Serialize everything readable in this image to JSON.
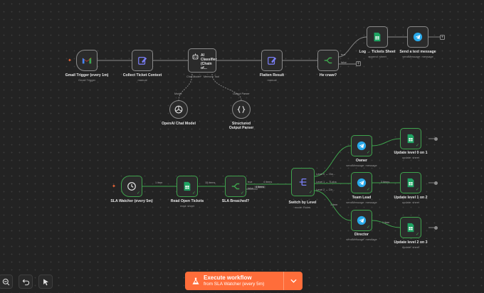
{
  "nodes": {
    "gmail_trigger": {
      "label": "Gmail Trigger (every 1m)",
      "sub": "Gmail Trigger",
      "icon": "gmail-icon"
    },
    "collect_ticket": {
      "label": "Collect Ticket Context",
      "sub": "manual",
      "icon": "edit-icon"
    },
    "ai_classifier": {
      "label": "AI Classifier (Chain of...",
      "icon": "robot-icon"
    },
    "flatten_result": {
      "label": "Flatten Result",
      "sub": "manual",
      "icon": "edit-icon"
    },
    "he_cnaw": {
      "label": "He cnaw?",
      "icon": "branch-icon"
    },
    "log_tickets": {
      "label": "Log → Tickets Sheet",
      "sub": "append: sheet",
      "icon": "sheets-icon"
    },
    "send_text": {
      "label": "Send a text message",
      "sub": "sendMessage: message",
      "icon": "telegram-icon"
    },
    "openai_model": {
      "label": "OpenAI Chat Model",
      "icon": "openai-icon"
    },
    "structured_parser": {
      "label": "Structured Output Parser",
      "icon": "braces-icon"
    },
    "sla_watcher": {
      "label": "SLA Watcher (every 5m)",
      "icon": "clock-icon"
    },
    "read_open": {
      "label": "Read Open Tickets",
      "sub": "read: sheet",
      "icon": "sheets-icon"
    },
    "sla_breached": {
      "label": "SLA Breached?",
      "icon": "branch-icon"
    },
    "switch_level": {
      "label": "Switch by Level",
      "sub": "mode: Rules",
      "icon": "switch-icon"
    },
    "owner": {
      "label": "Owner",
      "sub": "sendMessage: message",
      "icon": "telegram-icon"
    },
    "team_lead": {
      "label": "Team Lead",
      "sub": "sendMessage: message",
      "icon": "telegram-icon"
    },
    "director": {
      "label": "Director",
      "sub": "sendMessage: message",
      "icon": "telegram-icon"
    },
    "update_l0": {
      "label": "Update level 0 on 1",
      "sub": "update: sheet",
      "icon": "sheets-icon"
    },
    "update_l1": {
      "label": "Update level 1 on 2",
      "sub": "update: sheet",
      "icon": "sheets-icon"
    },
    "update_l2": {
      "label": "Update level 2 on 3",
      "sub": "update: sheet",
      "icon": "sheets-icon"
    }
  },
  "ports": {
    "chat_model": "Chat Model*",
    "memory": "Memory",
    "tool": "Tool",
    "model": "Model",
    "output_parser": "Output Parser",
    "true": "true",
    "false": "false",
    "level0": "Level 0 → Ow...",
    "level1": "Level 1 → TLsha",
    "level2": "Level 2 → Dir..."
  },
  "edge_labels": {
    "one_item_a": "1 item",
    "items_15": "15 items",
    "items_4a": "4 items",
    "items_4b": "4 items",
    "one_item_b": "1 item",
    "items_3": "3 items",
    "one_item_c": "1 item",
    "one_item_d": "1 item"
  },
  "toolbar": {
    "zoom_out": "zoom-out-icon",
    "undo": "undo-icon",
    "pointer": "pointer-icon"
  },
  "execute": {
    "title": "Execute workflow",
    "subtitle": "from SLA Watcher (every 5m)",
    "color": "#ff6d3a"
  },
  "colors": {
    "canvas": "#232323",
    "edge": "#8a8a8a",
    "active_edge": "#3fa34d",
    "sheets": "#1fa463",
    "telegram": "#29a9ea",
    "edit": "#7b7ff7"
  }
}
